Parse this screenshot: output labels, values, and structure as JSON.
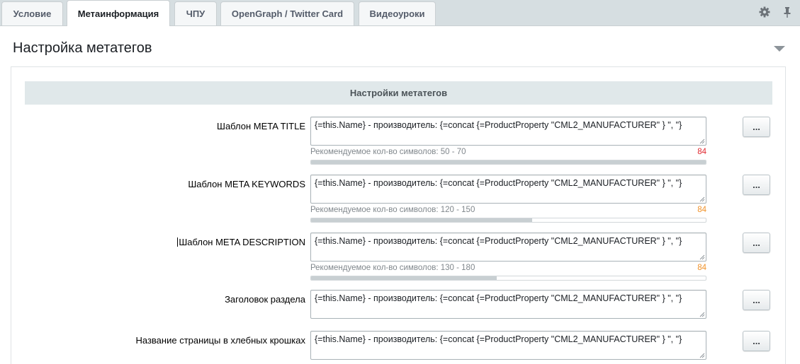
{
  "tabs": [
    {
      "label": "Условие",
      "active": false
    },
    {
      "label": "Метаинформация",
      "active": true
    },
    {
      "label": "ЧПУ",
      "active": false
    },
    {
      "label": "OpenGraph / Twitter Card",
      "active": false
    },
    {
      "label": "Видеоуроки",
      "active": false
    }
  ],
  "toolbar": {
    "settings_icon": "gear-icon",
    "pin_icon": "pin-icon"
  },
  "section": {
    "title": "Настройка метатегов",
    "subheader": "Настройки метатегов"
  },
  "fields": [
    {
      "label": "Шаблон META TITLE",
      "value": "{=this.Name} - производитель: {=concat {=ProductProperty \"CML2_MANUFACTURER\" } \", \"}",
      "hint": "Рекомендуемое кол-во символов: 50 - 70",
      "count": "84",
      "count_color": "#e0282f",
      "progress": 1.0,
      "button": "..."
    },
    {
      "label": "Шаблон META KEYWORDS",
      "value": "{=this.Name} - производитель: {=concat {=ProductProperty \"CML2_MANUFACTURER\" } \", \"}",
      "hint": "Рекомендуемое кол-во символов: 120 - 150",
      "count": "84",
      "count_color": "#f0922a",
      "progress": 0.56,
      "button": "..."
    },
    {
      "label": "Шаблон META DESCRIPTION",
      "value": "{=this.Name} - производитель: {=concat {=ProductProperty \"CML2_MANUFACTURER\" } \", \"}",
      "hint": "Рекомендуемое кол-во символов: 130 - 180",
      "count": "84",
      "count_color": "#f0922a",
      "progress": 0.47,
      "button": "..."
    },
    {
      "label": "Заголовок раздела",
      "value": "{=this.Name} - производитель: {=concat {=ProductProperty \"CML2_MANUFACTURER\" } \", \"}",
      "button": "..."
    },
    {
      "label": "Название страницы в хлебных крошках",
      "value": "{=this.Name} - производитель: {=concat {=ProductProperty \"CML2_MANUFACTURER\" } \", \"}",
      "button": "..."
    }
  ]
}
